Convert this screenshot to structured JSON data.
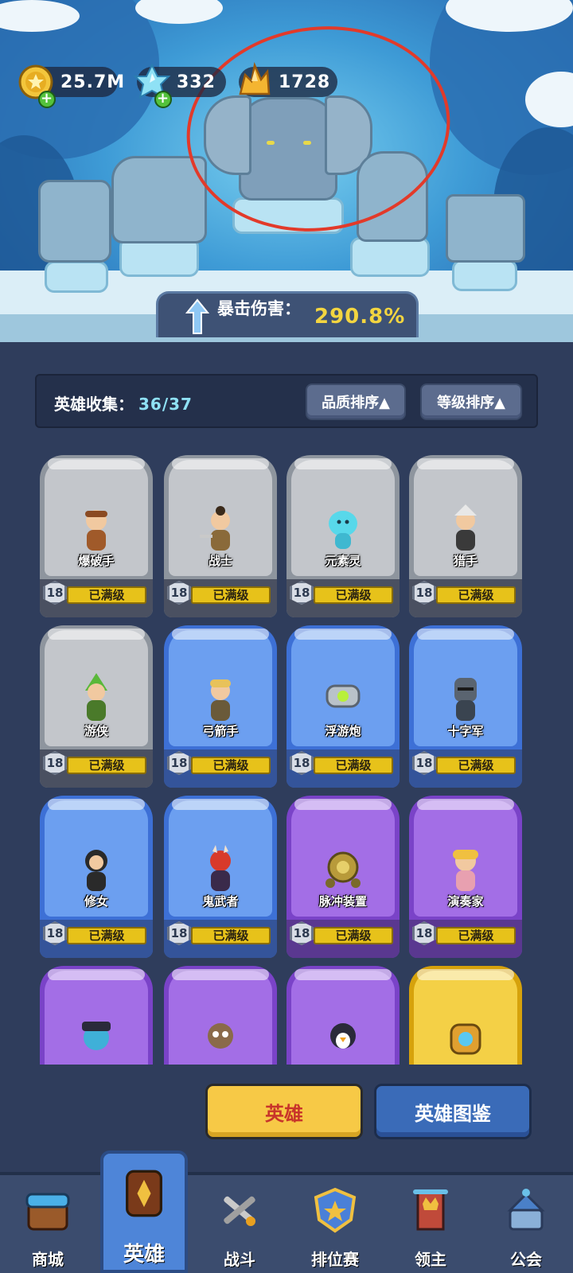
{
  "resources": {
    "gold": {
      "value": "25.7M",
      "icon": "gold-coin-icon"
    },
    "crystal": {
      "value": "332",
      "icon": "blue-crystal-icon"
    },
    "gem": {
      "value": "1728",
      "icon": "gold-gem-icon"
    }
  },
  "crit_bar": {
    "label": "暴击伤害：",
    "value": "290.8%"
  },
  "collection": {
    "label": "英雄收集：",
    "count": "36/37"
  },
  "sort": {
    "quality": "品质排序▲",
    "level": "等级排序▲"
  },
  "heroes": [
    {
      "name": "爆破手",
      "level": "18",
      "status": "已满级",
      "rarity": "grey"
    },
    {
      "name": "战士",
      "level": "18",
      "status": "已满级",
      "rarity": "grey"
    },
    {
      "name": "元素灵",
      "level": "18",
      "status": "已满级",
      "rarity": "grey"
    },
    {
      "name": "猎手",
      "level": "18",
      "status": "已满级",
      "rarity": "grey"
    },
    {
      "name": "游侠",
      "level": "18",
      "status": "已满级",
      "rarity": "grey"
    },
    {
      "name": "弓箭手",
      "level": "18",
      "status": "已满级",
      "rarity": "blue"
    },
    {
      "name": "浮游炮",
      "level": "18",
      "status": "已满级",
      "rarity": "blue"
    },
    {
      "name": "十字军",
      "level": "18",
      "status": "已满级",
      "rarity": "blue"
    },
    {
      "name": "修女",
      "level": "18",
      "status": "已满级",
      "rarity": "blue"
    },
    {
      "name": "鬼武者",
      "level": "18",
      "status": "已满级",
      "rarity": "blue"
    },
    {
      "name": "脉冲装置",
      "level": "18",
      "status": "已满级",
      "rarity": "purple"
    },
    {
      "name": "演奏家",
      "level": "18",
      "status": "已满级",
      "rarity": "purple"
    }
  ],
  "partial_heroes": [
    {
      "rarity": "purple"
    },
    {
      "rarity": "purple"
    },
    {
      "rarity": "purple"
    },
    {
      "rarity": "gold"
    }
  ],
  "buttons": {
    "hero": "英雄",
    "dex": "英雄图鉴"
  },
  "nav": [
    {
      "label": "商城",
      "icon": "shop-chest-icon"
    },
    {
      "label": "英雄",
      "icon": "hero-card-icon",
      "active": true
    },
    {
      "label": "战斗",
      "icon": "crossed-swords-icon"
    },
    {
      "label": "排位赛",
      "icon": "rank-shield-icon"
    },
    {
      "label": "领主",
      "icon": "lord-banner-icon"
    },
    {
      "label": "公会",
      "icon": "guild-castle-icon"
    }
  ],
  "colors": {
    "annotation_circle": "#e23a2a",
    "crit_value": "#f3d540",
    "count": "#8fe1f5"
  }
}
